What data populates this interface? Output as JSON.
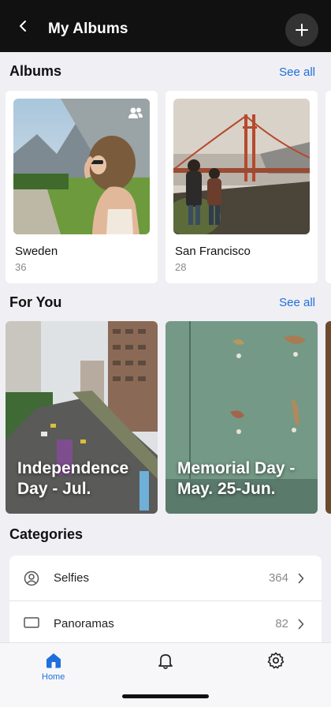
{
  "header": {
    "title": "My Albums",
    "back_icon": "chevron-left-icon",
    "add_icon": "plus-icon"
  },
  "albums": {
    "title": "Albums",
    "see_all": "See all",
    "items": [
      {
        "name": "Sweden",
        "count": "36",
        "shared": true
      },
      {
        "name": "San Francisco",
        "count": "28",
        "shared": false
      }
    ]
  },
  "for_you": {
    "title": "For You",
    "see_all": "See all",
    "items": [
      {
        "label": "Independence Day - Jul."
      },
      {
        "label": "Memorial Day - May. 25-Jun."
      }
    ]
  },
  "categories": {
    "title": "Categories",
    "items": [
      {
        "label": "Selfies",
        "count": "364",
        "icon": "person-circle-icon"
      },
      {
        "label": "Panoramas",
        "count": "82",
        "icon": "panorama-icon"
      }
    ]
  },
  "tabbar": {
    "items": [
      {
        "label": "Home",
        "icon": "home-icon",
        "active": true
      },
      {
        "label": "",
        "icon": "bell-icon",
        "active": false
      },
      {
        "label": "",
        "icon": "gear-icon",
        "active": false
      }
    ]
  },
  "colors": {
    "accent": "#1e6fdb",
    "header_bg": "#111111",
    "page_bg": "#efeff4"
  }
}
